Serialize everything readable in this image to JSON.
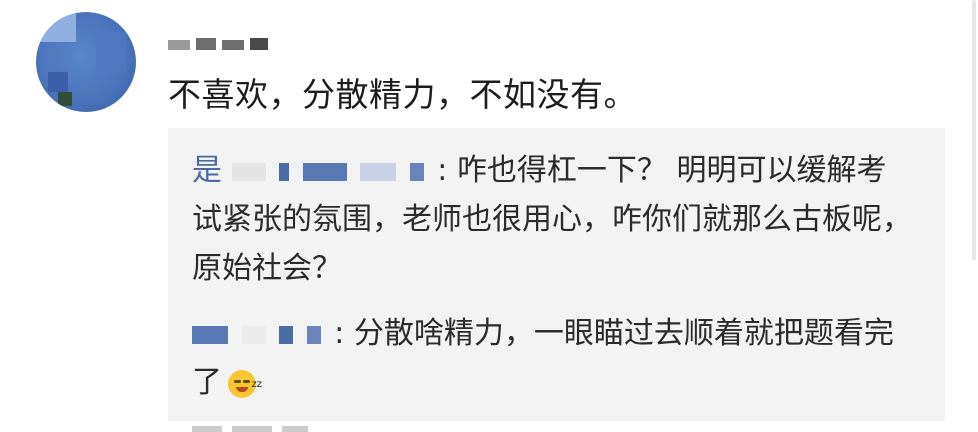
{
  "comment": {
    "username": "",
    "text": "不喜欢，分散精力，不如没有。"
  },
  "replies": [
    {
      "author": "是",
      "separator": ":",
      "text": "咋也得杠一下？ 明明可以缓解考试紧张的氛围，老师也很用心，咋你们就那么古板呢，原始社会？"
    },
    {
      "author": "",
      "separator": ":",
      "text": "分散啥精力，一眼瞄过去顺着就把题看完了"
    }
  ],
  "colors": {
    "author": "#4b6aa6",
    "reply_background": "#f3f3f3",
    "comment_text": "#1d1d1d"
  },
  "icons": {
    "avatar": "blurred-avatar",
    "emoji": "sleepy-grin-emoji"
  }
}
